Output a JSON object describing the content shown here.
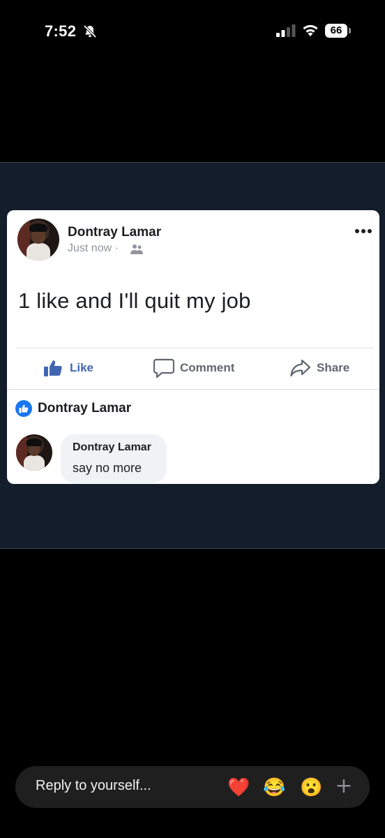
{
  "status_bar": {
    "time": "7:52",
    "battery": "66",
    "icons": [
      "bell-slash-icon",
      "signal-icon",
      "wifi-icon",
      "battery-icon"
    ]
  },
  "post": {
    "author": "Dontray Lamar",
    "meta": "Just now ·",
    "privacy_icon": "friends-icon",
    "text": "1 like and I'll quit my job",
    "actions": {
      "like": "Like",
      "comment": "Comment",
      "share": "Share"
    },
    "liked_by": "Dontray Lamar",
    "comment": {
      "author": "Dontray Lamar",
      "text": "say no more"
    }
  },
  "reply_bar": {
    "placeholder": "Reply to yourself...",
    "reactions": [
      "❤️",
      "😂",
      "😮"
    ],
    "more": "+"
  },
  "colors": {
    "facebook_blue": "#4267b2",
    "story_background": "#141d2b",
    "reply_bar": "#1f1f1f"
  }
}
